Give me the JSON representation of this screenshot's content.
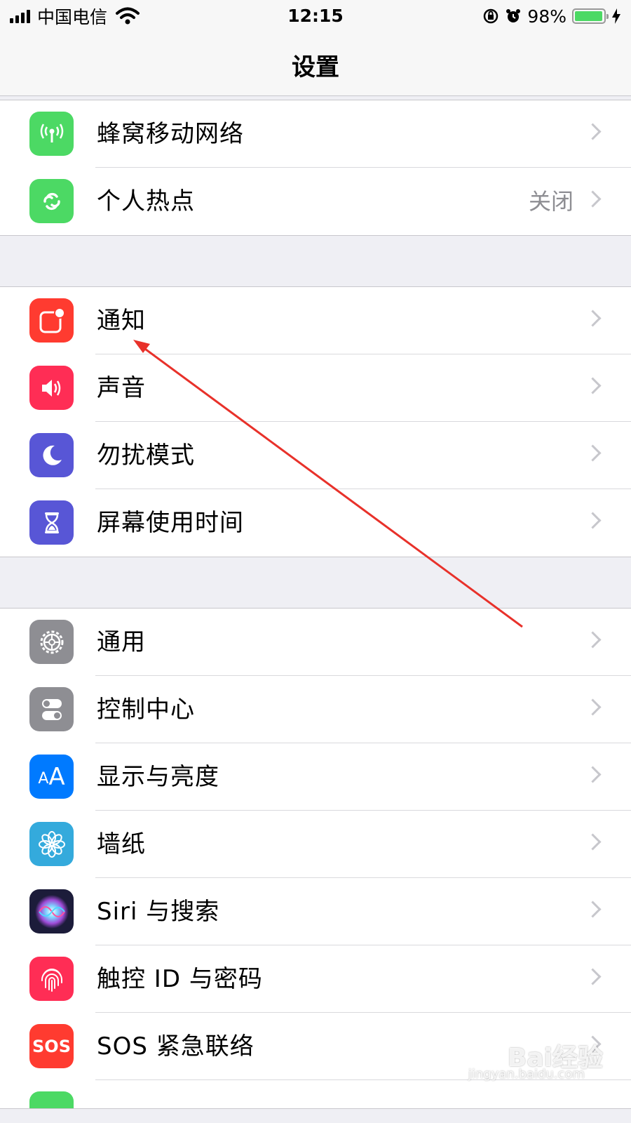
{
  "status_bar": {
    "carrier": "中国电信",
    "time": "12:15",
    "battery_percent": "98%",
    "battery_level": 0.98,
    "icons": [
      "signal-icon",
      "wifi-icon",
      "rotation-lock-icon",
      "alarm-icon",
      "battery-icon",
      "charging-icon"
    ]
  },
  "nav": {
    "title": "设置"
  },
  "groups": [
    {
      "items": [
        {
          "label": "蜂窝移动网络",
          "icon": "cellular-icon",
          "color": "#4cd964"
        },
        {
          "label": "个人热点",
          "value": "关闭",
          "icon": "hotspot-icon",
          "color": "#4cd964"
        }
      ]
    },
    {
      "items": [
        {
          "label": "通知",
          "icon": "notifications-icon",
          "color": "#ff3b30"
        },
        {
          "label": "声音",
          "icon": "sounds-icon",
          "color": "#ff2d55"
        },
        {
          "label": "勿扰模式",
          "icon": "moon-icon",
          "color": "#5856d6"
        },
        {
          "label": "屏幕使用时间",
          "icon": "hourglass-icon",
          "color": "#5856d6"
        }
      ]
    },
    {
      "items": [
        {
          "label": "通用",
          "icon": "gear-icon",
          "color": "#8e8e93"
        },
        {
          "label": "控制中心",
          "icon": "control-center-icon",
          "color": "#8e8e93"
        },
        {
          "label": "显示与亮度",
          "icon": "display-icon",
          "icon_text": "AA",
          "color": "#007aff"
        },
        {
          "label": "墙纸",
          "icon": "wallpaper-icon",
          "color": "#34aadc"
        },
        {
          "label": "Siri 与搜索",
          "icon": "siri-icon",
          "color": "#1c1c3a"
        },
        {
          "label": "触控 ID 与密码",
          "icon": "fingerprint-icon",
          "color": "#ff2d55"
        },
        {
          "label": "SOS 紧急联络",
          "icon": "sos-icon",
          "icon_text": "SOS",
          "color": "#ff3b30"
        }
      ]
    }
  ],
  "annotation": {
    "color": "#e8312a",
    "target": "通知"
  },
  "watermark": {
    "text": "Bai经验",
    "sub": "jingyan.baidu.com"
  }
}
